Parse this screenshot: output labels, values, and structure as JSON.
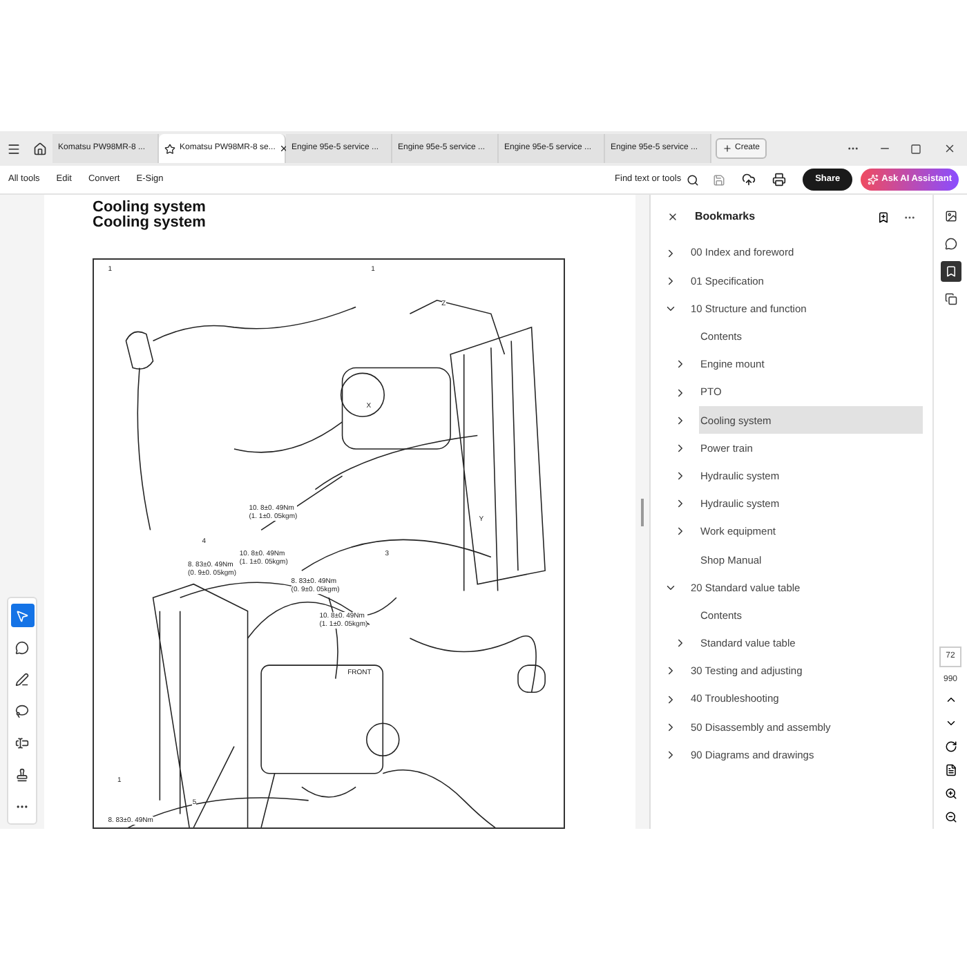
{
  "tabs": [
    {
      "label": "Komatsu PW98MR-8 ...",
      "selected": false
    },
    {
      "label": "Komatsu PW98MR-8 se...",
      "selected": true
    },
    {
      "label": "Engine 95e-5 service ...",
      "selected": false
    },
    {
      "label": "Engine 95e-5 service ...",
      "selected": false
    },
    {
      "label": "Engine 95e-5 service ...",
      "selected": false
    },
    {
      "label": "Engine 95e-5 service ...",
      "selected": false
    }
  ],
  "create_button": "Create",
  "menu": [
    "All tools",
    "Edit",
    "Convert",
    "E-Sign"
  ],
  "search": {
    "label": "Find text or tools"
  },
  "share_button": "Share",
  "ai_button": "Ask AI Assistant",
  "document": {
    "titles": [
      "Cooling system",
      "Cooling system"
    ],
    "callouts": [
      {
        "text": "1"
      },
      {
        "text": "1"
      },
      {
        "text": "Z"
      },
      {
        "text": "X"
      },
      {
        "text": "Y"
      },
      {
        "text": "3"
      },
      {
        "text": "10. 8±0. 49Nm\n(1. 1±0. 05kgm)"
      },
      {
        "text": "8. 83±0. 49Nm\n(0. 9±0. 05kgm)"
      },
      {
        "text": "4"
      },
      {
        "text": "10. 8±0. 49Nm\n(1. 1±0. 05kgm)"
      },
      {
        "text": "8. 83±0. 49Nm\n(0. 9±0. 05kgm)"
      },
      {
        "text": "10. 8±0. 49Nm\n(1. 1±0. 05kgm)"
      },
      {
        "text": "FRONT"
      },
      {
        "text": "1"
      },
      {
        "text": "5"
      },
      {
        "text": "8. 83±0. 49Nm"
      }
    ]
  },
  "tools": [
    {
      "kind": "select",
      "selected": true
    },
    {
      "kind": "comment",
      "selected": false
    },
    {
      "kind": "pen",
      "selected": false
    },
    {
      "kind": "lasso",
      "selected": false
    },
    {
      "kind": "text",
      "selected": false
    },
    {
      "kind": "stamp",
      "selected": false
    },
    {
      "kind": "more",
      "selected": false
    }
  ],
  "bookmarks": {
    "title": "Bookmarks",
    "items": [
      {
        "label": "00 Index and foreword",
        "kind": "branch",
        "expanded": false,
        "selected": false
      },
      {
        "label": "01 Specification",
        "kind": "branch",
        "expanded": false,
        "selected": false
      },
      {
        "label": "10 Structure and function",
        "kind": "branch",
        "expanded": true,
        "selected": false,
        "children": [
          {
            "label": "Contents",
            "kind": "leaf",
            "selected": false
          },
          {
            "label": "Engine mount",
            "kind": "branch",
            "expanded": false,
            "selected": false
          },
          {
            "label": "PTO",
            "kind": "branch",
            "expanded": false,
            "selected": false
          },
          {
            "label": "Cooling system",
            "kind": "branch",
            "expanded": false,
            "selected": true
          },
          {
            "label": "Power train",
            "kind": "branch",
            "expanded": false,
            "selected": false
          },
          {
            "label": "Hydraulic system",
            "kind": "branch",
            "expanded": false,
            "selected": false
          },
          {
            "label": "Hydraulic system",
            "kind": "branch",
            "expanded": false,
            "selected": false
          },
          {
            "label": "Work equipment",
            "kind": "branch",
            "expanded": false,
            "selected": false
          },
          {
            "label": "Shop Manual",
            "kind": "leaf",
            "selected": false
          }
        ]
      },
      {
        "label": "20 Standard value table",
        "kind": "branch",
        "expanded": true,
        "selected": false,
        "children": [
          {
            "label": "Contents",
            "kind": "leaf",
            "selected": false
          },
          {
            "label": "Standard value table",
            "kind": "branch",
            "expanded": false,
            "selected": false
          }
        ]
      },
      {
        "label": "30 Testing and adjusting",
        "kind": "branch",
        "expanded": false,
        "selected": false
      },
      {
        "label": "40 Troubleshooting",
        "kind": "branch",
        "expanded": false,
        "selected": false
      },
      {
        "label": "50 Disassembly and assembly",
        "kind": "branch",
        "expanded": false,
        "selected": false
      },
      {
        "label": "90 Diagrams and drawings",
        "kind": "branch",
        "expanded": false,
        "selected": false
      }
    ]
  },
  "page_number": "72",
  "page_count": "990"
}
